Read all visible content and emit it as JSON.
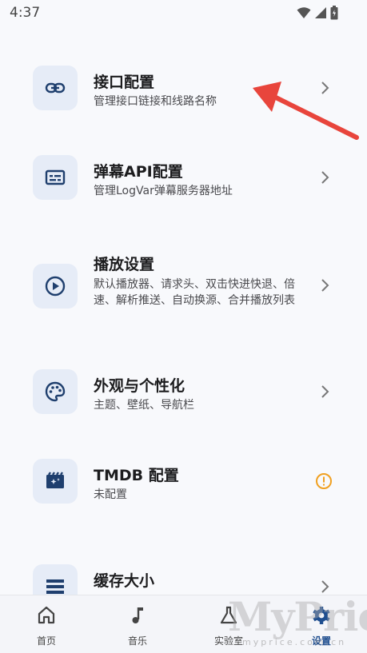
{
  "status_bar": {
    "time": "4:37"
  },
  "settings_items": [
    {
      "title": "接口配置",
      "subtitle": "管理接口链接和线路名称",
      "icon": "link-icon",
      "trailing": "chevron-right-icon"
    },
    {
      "title": "弹幕API配置",
      "subtitle": "管理LogVar弹幕服务器地址",
      "icon": "subtitles-icon",
      "trailing": "chevron-right-icon"
    },
    {
      "title": "播放设置",
      "subtitle": "默认播放器、请求头、双击快进快退、倍速、解析推送、自动换源、合并播放列表",
      "icon": "play-circle-icon",
      "trailing": "chevron-right-icon"
    },
    {
      "title": "外观与个性化",
      "subtitle": "主题、壁纸、导航栏",
      "icon": "palette-icon",
      "trailing": "chevron-right-icon"
    },
    {
      "title": "TMDB 配置",
      "subtitle": "未配置",
      "icon": "movie-clapper-icon",
      "trailing": "warning-circle-icon"
    },
    {
      "title": "缓存大小",
      "subtitle": "",
      "icon": "storage-icon",
      "trailing": "chevron-right-icon"
    }
  ],
  "bottom_nav": [
    {
      "label": "首页",
      "icon": "home-icon",
      "active": false
    },
    {
      "label": "音乐",
      "icon": "music-note-icon",
      "active": false
    },
    {
      "label": "实验室",
      "icon": "flask-icon",
      "active": false
    },
    {
      "label": "设置",
      "icon": "gear-icon",
      "active": true
    }
  ],
  "watermark": {
    "text": "MyPrice",
    "url_text": "myprice.com.cn"
  },
  "colors": {
    "accent": "#1f4e8f",
    "icon_bg": "#e6ecf7",
    "warning": "#f0a020",
    "annotation_arrow": "#e8453c"
  }
}
